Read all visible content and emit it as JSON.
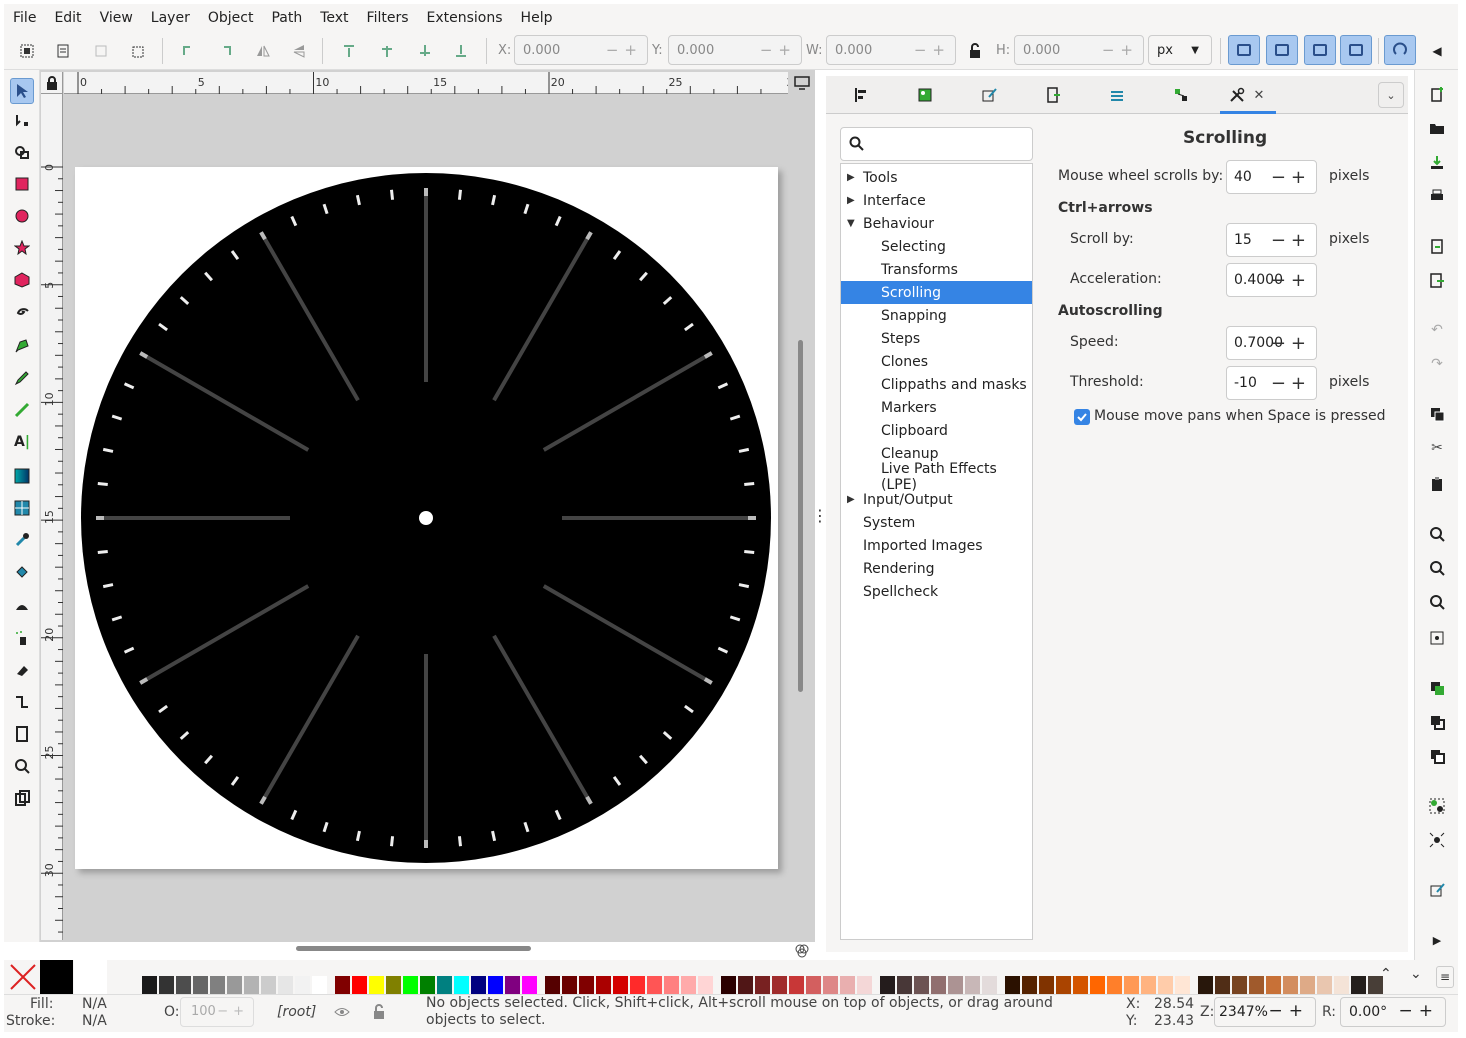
{
  "menubar": {
    "items": [
      "File",
      "Edit",
      "View",
      "Layer",
      "Object",
      "Path",
      "Text",
      "Filters",
      "Extensions",
      "Help"
    ]
  },
  "toolbar": {
    "x_label": "X:",
    "x_value": "0.000",
    "y_label": "Y:",
    "y_value": "0.000",
    "w_label": "W:",
    "w_value": "0.000",
    "h_label": "H:",
    "h_value": "0.000",
    "unit": "px"
  },
  "ruler": {
    "h_ticks": [
      "0",
      "5",
      "10",
      "15",
      "20",
      "25",
      "3"
    ],
    "v_ticks": [
      "0",
      "5",
      "10",
      "15",
      "20",
      "25",
      "30"
    ]
  },
  "preferences": {
    "search_placeholder": "",
    "tree": [
      {
        "label": "Tools",
        "arrow": "▸",
        "indent": 0
      },
      {
        "label": "Interface",
        "arrow": "▸",
        "indent": 0
      },
      {
        "label": "Behaviour",
        "arrow": "▾",
        "indent": 0
      },
      {
        "label": "Selecting",
        "arrow": "",
        "indent": 1
      },
      {
        "label": "Transforms",
        "arrow": "",
        "indent": 1
      },
      {
        "label": "Scrolling",
        "arrow": "",
        "indent": 1,
        "selected": true
      },
      {
        "label": "Snapping",
        "arrow": "",
        "indent": 1
      },
      {
        "label": "Steps",
        "arrow": "",
        "indent": 1
      },
      {
        "label": "Clones",
        "arrow": "",
        "indent": 1
      },
      {
        "label": "Clippaths and masks",
        "arrow": "",
        "indent": 1
      },
      {
        "label": "Markers",
        "arrow": "",
        "indent": 1
      },
      {
        "label": "Clipboard",
        "arrow": "",
        "indent": 1
      },
      {
        "label": "Cleanup",
        "arrow": "",
        "indent": 1
      },
      {
        "label": "Live Path Effects (LPE)",
        "arrow": "",
        "indent": 1
      },
      {
        "label": "Input/Output",
        "arrow": "▸",
        "indent": 0
      },
      {
        "label": "System",
        "arrow": "",
        "indent": 0
      },
      {
        "label": "Imported Images",
        "arrow": "",
        "indent": 0
      },
      {
        "label": "Rendering",
        "arrow": "",
        "indent": 0
      },
      {
        "label": "Spellcheck",
        "arrow": "",
        "indent": 0
      }
    ],
    "page_title": "Scrolling",
    "wheel_label": "Mouse wheel scrolls by:",
    "wheel_value": "40",
    "wheel_unit": "pixels",
    "ctrl_heading": "Ctrl+arrows",
    "scrollby_label": "Scroll by:",
    "scrollby_value": "15",
    "scrollby_unit": "pixels",
    "accel_label": "Acceleration:",
    "accel_value": "0.4000",
    "auto_heading": "Autoscrolling",
    "speed_label": "Speed:",
    "speed_value": "0.7000",
    "threshold_label": "Threshold:",
    "threshold_value": "-10",
    "threshold_unit": "pixels",
    "space_pan_label": "Mouse move pans when Space is pressed",
    "space_pan_checked": true
  },
  "palette": {
    "colors": [
      "#000000",
      "#ffffff",
      "#1a1a1a",
      "#333333",
      "#4d4d4d",
      "#666666",
      "#808080",
      "#999999",
      "#b3b3b3",
      "#cccccc",
      "#e6e6e6",
      "#f2f2f2",
      "#ffffff",
      "#800000",
      "#ff0000",
      "#ffff00",
      "#808000",
      "#00ff00",
      "#008000",
      "#008080",
      "#00ffff",
      "#000080",
      "#0000ff",
      "#800080",
      "#ff00ff",
      "#550000",
      "#6b0000",
      "#800000",
      "#aa0000",
      "#d40000",
      "#ff2a2a",
      "#ff5555",
      "#ff8080",
      "#ffaaaa",
      "#ffd5d5",
      "#2b0000",
      "#501616",
      "#782121",
      "#a02c2c",
      "#c83737",
      "#d35f5f",
      "#de8787",
      "#e9afaf",
      "#f4d7d7",
      "#241c1c",
      "#483737",
      "#6c5353",
      "#916f6f",
      "#ac9393",
      "#c8b7b7",
      "#e3dbdb",
      "#2b1100",
      "#552200",
      "#803300",
      "#aa4400",
      "#d45500",
      "#ff6600",
      "#ff7f2a",
      "#ff9955",
      "#ffb380",
      "#ffccaa",
      "#ffe6d5",
      "#28170b",
      "#502d16",
      "#784421",
      "#a05a2c",
      "#c87137",
      "#d38d5f",
      "#deaa87",
      "#e9c6af",
      "#f4e3d7",
      "#241f1c",
      "#483e37"
    ]
  },
  "status": {
    "fill_label": "Fill:",
    "fill_value": "N/A",
    "stroke_label": "Stroke:",
    "stroke_value": "N/A",
    "opacity_label": "O:",
    "opacity_value": "100",
    "layer": "[root]",
    "message": "No objects selected. Click, Shift+click, Alt+scroll mouse on top of objects, or drag around objects to select.",
    "x_label": "X:",
    "x_value": "28.54",
    "y_label": "Y:",
    "y_value": "23.43",
    "zoom_label": "Z:",
    "zoom_value": "2347%",
    "rot_label": "R:",
    "rot_value": "0.00°"
  },
  "colors": {
    "accent": "#3584e4",
    "selection_blue": "#a8c8f0",
    "clock_face": "#000000"
  }
}
